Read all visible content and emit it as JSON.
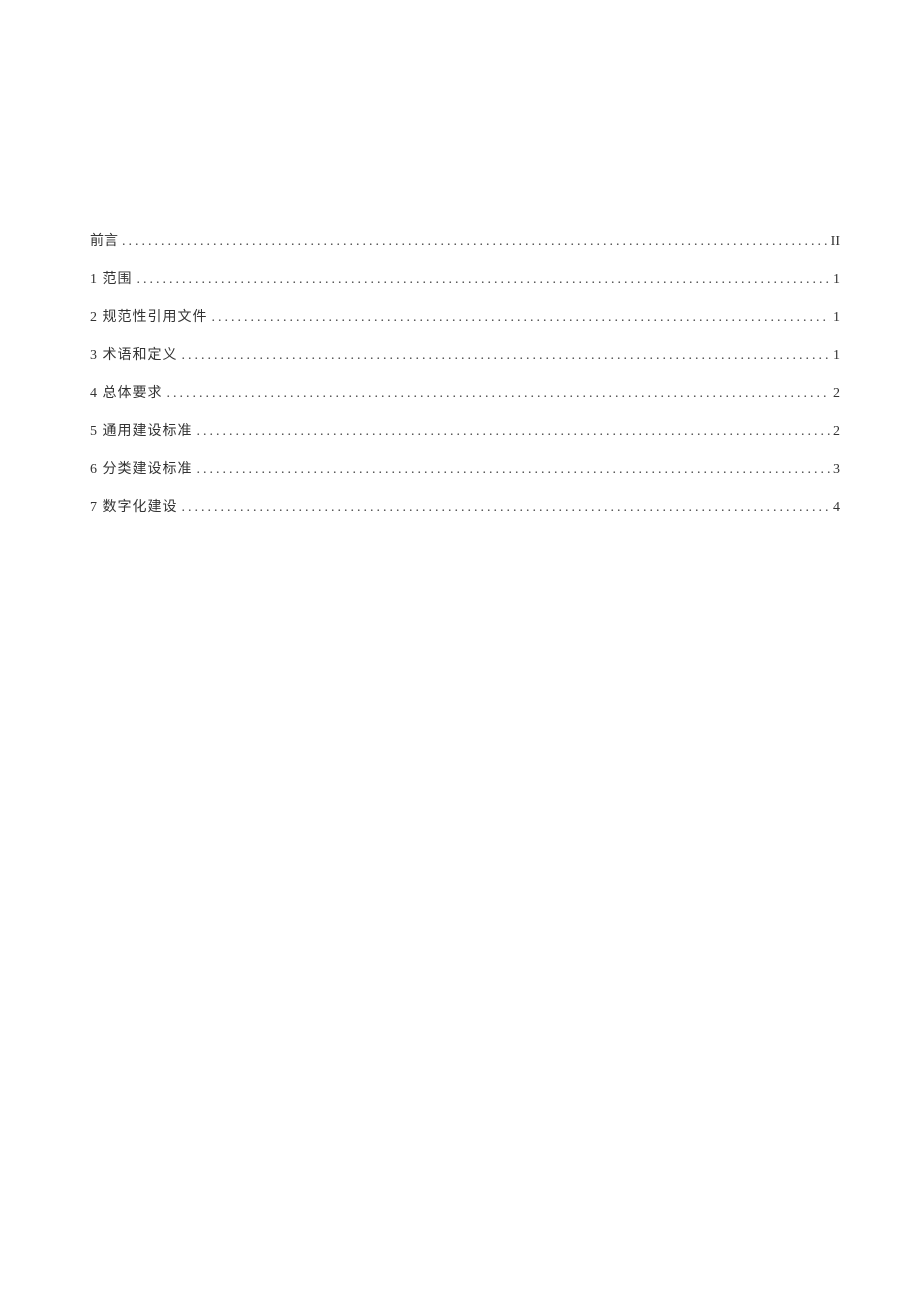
{
  "toc": {
    "entries": [
      {
        "label": "前言",
        "page": "II"
      },
      {
        "label": "1 范围",
        "page": "1"
      },
      {
        "label": "2 规范性引用文件",
        "page": "1"
      },
      {
        "label": "3 术语和定义",
        "page": "1"
      },
      {
        "label": "4 总体要求",
        "page": "2"
      },
      {
        "label": "5 通用建设标准",
        "page": "2"
      },
      {
        "label": "6 分类建设标准",
        "page": "3"
      },
      {
        "label": "7 数字化建设",
        "page": "4"
      }
    ]
  }
}
